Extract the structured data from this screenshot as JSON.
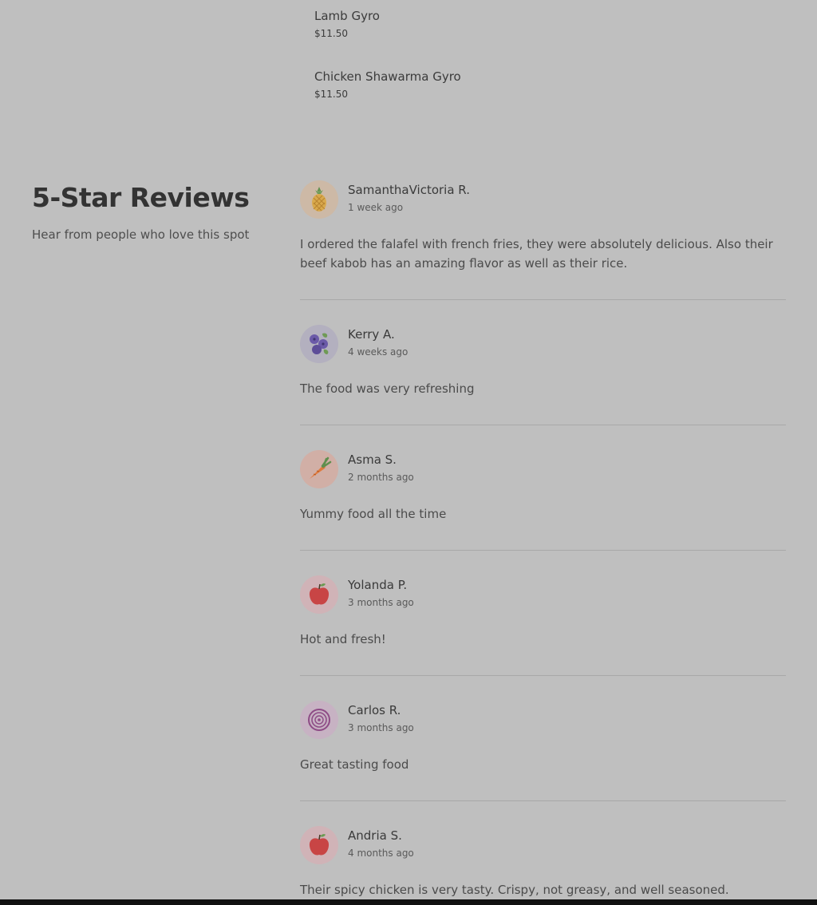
{
  "menu": {
    "items": [
      {
        "name": "Lamb Gyro",
        "price": "$11.50"
      },
      {
        "name": "Chicken Shawarma Gyro",
        "price": "$11.50"
      }
    ]
  },
  "reviews_section": {
    "title": "5-Star Reviews",
    "subtitle": "Hear from people who love this spot",
    "reviews": [
      {
        "name": "SamanthaVictoria R.",
        "date": "1 week ago",
        "avatar_icon": "pineapple-icon",
        "avatar_bg": "#cdb9a6",
        "text": "I ordered the falafel with french fries, they were absolutely delicious. Also their beef kabob has an amazing flavor as well as their rice."
      },
      {
        "name": "Kerry A.",
        "date": "4 weeks ago",
        "avatar_icon": "blueberries-icon",
        "avatar_bg": "#b3b0bf",
        "text": "The food was very refreshing"
      },
      {
        "name": "Asma S.",
        "date": "2 months ago",
        "avatar_icon": "carrot-icon",
        "avatar_bg": "#d1afa6",
        "text": "Yummy food all the time"
      },
      {
        "name": "Yolanda P.",
        "date": "3 months ago",
        "avatar_icon": "apple-icon",
        "avatar_bg": "#d0b3b7",
        "text": "Hot and fresh!"
      },
      {
        "name": "Carlos R.",
        "date": "3 months ago",
        "avatar_icon": "onion-icon",
        "avatar_bg": "#c7b2c3",
        "text": "Great tasting food"
      },
      {
        "name": "Andria S.",
        "date": "4 months ago",
        "avatar_icon": "apple-icon",
        "avatar_bg": "#d0b3b7",
        "text": "Their spicy chicken is very tasty. Crispy, not greasy, and well seasoned."
      }
    ]
  }
}
